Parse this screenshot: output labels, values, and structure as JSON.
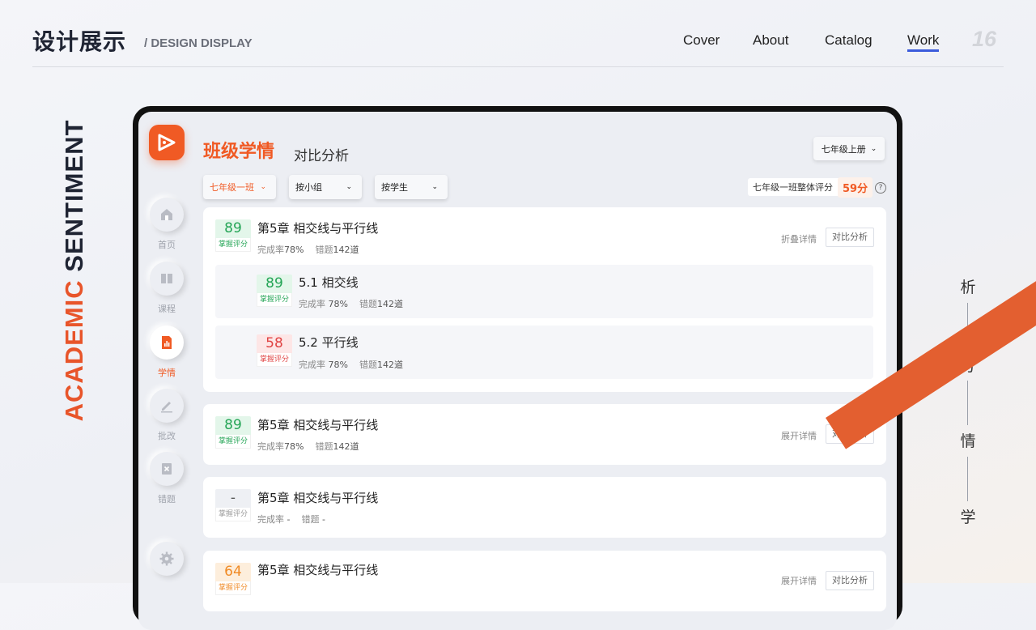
{
  "header": {
    "title": "设计展示",
    "subtitle": "/ DESIGN DISPLAY",
    "nav": [
      "Cover",
      "About",
      "Catalog",
      "Work"
    ],
    "active_nav": "Work",
    "page_number": "16"
  },
  "side_text": {
    "part1": "ACADEMIC",
    "part2": "SENTIMENT"
  },
  "right_text": [
    "析",
    "分",
    "情",
    "学"
  ],
  "colors": {
    "accent": "#f05a24",
    "stripe": "#e35f30",
    "nav_underline": "#3b5bdb",
    "good": "#24a556",
    "bad": "#e04343",
    "warn": "#f08a24"
  },
  "app": {
    "title": "班级学情",
    "subtitle": "对比分析",
    "grade_select": "七年级上册",
    "filters": [
      "七年级一班",
      "按小组",
      "按学生"
    ],
    "overall_label": "七年级一班整体评分",
    "overall_score": "59分",
    "help_icon": "?"
  },
  "sidebar": [
    {
      "icon": "home-icon",
      "label": "首页"
    },
    {
      "icon": "book-icon",
      "label": "课程"
    },
    {
      "icon": "chart-icon",
      "label": "学情",
      "active": true
    },
    {
      "icon": "pen-icon",
      "label": "批改"
    },
    {
      "icon": "error-icon",
      "label": "错题"
    },
    {
      "icon": "gear-icon",
      "label": ""
    }
  ],
  "cards": [
    {
      "score": "89",
      "score_label": "掌握评分",
      "title": "第5章 相交线与平行线",
      "rate_label": "完成率",
      "rate": "78%",
      "err_label": "错题",
      "err": "142道",
      "toggle": "折叠详情",
      "compare": "对比分析",
      "subs": [
        {
          "score": "89",
          "score_label": "掌握评分",
          "title": "5.1 相交线",
          "rate_label": "完成率",
          "rate": "78%",
          "err_label": "错题",
          "err": "142道"
        },
        {
          "score": "58",
          "score_label": "掌握评分",
          "title": "5.2 平行线",
          "rate_label": "完成率",
          "rate": "78%",
          "err_label": "错题",
          "err": "142道"
        }
      ]
    },
    {
      "score": "89",
      "score_label": "掌握评分",
      "title": "第5章 相交线与平行线",
      "rate_label": "完成率",
      "rate": "78%",
      "err_label": "错题",
      "err": "142道",
      "toggle": "展开详情",
      "compare": "对比分析"
    },
    {
      "score": "-",
      "score_label": "掌握评分",
      "title": "第5章 相交线与平行线",
      "rate_label": "完成率",
      "rate": "-",
      "err_label": "错题",
      "err": "-"
    },
    {
      "score": "64",
      "score_label": "掌握评分",
      "title": "第5章 相交线与平行线",
      "toggle": "展开详情",
      "compare": "对比分析"
    }
  ]
}
